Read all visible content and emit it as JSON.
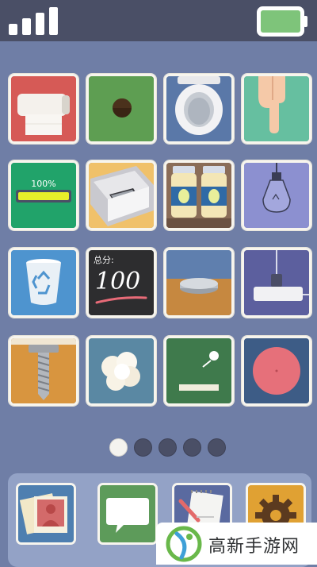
{
  "status_bar": {
    "signal_bars": 4,
    "battery_level": 1.0,
    "battery_color": "#7ec47a"
  },
  "apps": [
    {
      "name": "toilet-paper",
      "bg": "#d65a56"
    },
    {
      "name": "hole",
      "bg": "#5e9e52"
    },
    {
      "name": "toilet",
      "bg": "#5a78a8"
    },
    {
      "name": "pointing-hand",
      "bg": "#66bfa0"
    },
    {
      "name": "battery-progress",
      "bg": "#21a36a",
      "label": "100%",
      "progress": 1.0
    },
    {
      "name": "phone-in-box",
      "bg": "#f0c16a"
    },
    {
      "name": "jars",
      "bg": "#8a6d58"
    },
    {
      "name": "light-bulb",
      "bg": "#8c90d0"
    },
    {
      "name": "recycle-bin",
      "bg": "#4e94cf"
    },
    {
      "name": "chalkboard-score",
      "bg": "#2d2d2f",
      "label": "总分:",
      "score": "100"
    },
    {
      "name": "coin-on-table",
      "bg": "#5f7fae"
    },
    {
      "name": "power-plug",
      "bg": "#5c5f9e"
    },
    {
      "name": "screw",
      "bg": "#d8953f"
    },
    {
      "name": "popcorn",
      "bg": "#5a88a3"
    },
    {
      "name": "ball-paddle",
      "bg": "#3f7a4c"
    },
    {
      "name": "pink-ball",
      "bg": "#3d5c86"
    }
  ],
  "page_indicator": {
    "count": 5,
    "active": 1
  },
  "dock": [
    {
      "name": "photos",
      "bg": "#4e7fb0"
    },
    {
      "name": "messages",
      "bg": "#5d9b5a"
    },
    {
      "name": "notes",
      "bg": "#5a6aa0"
    },
    {
      "name": "settings",
      "bg": "#e0a133"
    }
  ],
  "watermark": {
    "text": "高新手游网"
  }
}
